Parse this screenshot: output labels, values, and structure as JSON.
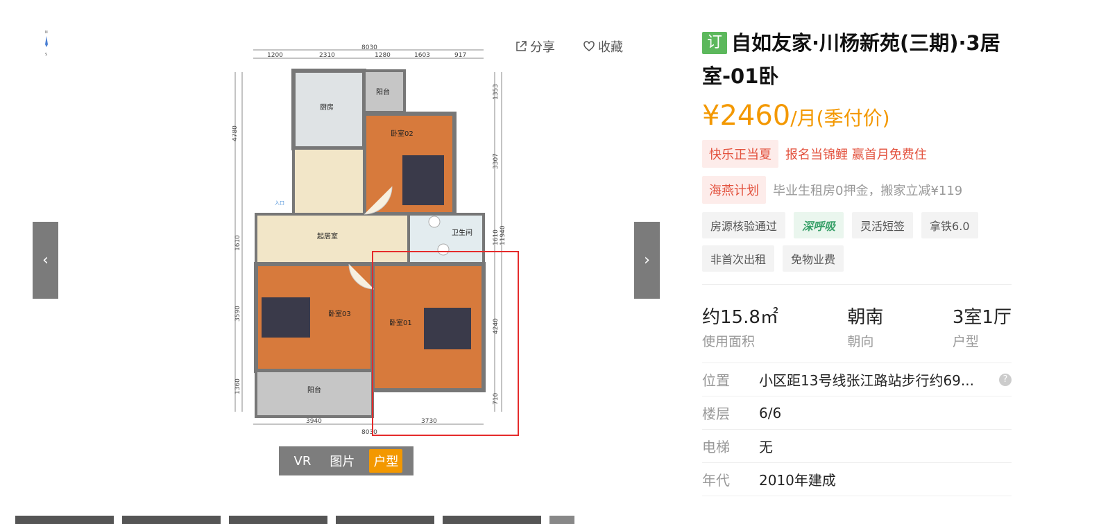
{
  "actions": {
    "share": "分享",
    "favorite": "收藏"
  },
  "media_tabs": [
    "VR",
    "图片",
    "户型"
  ],
  "active_tab": "户型",
  "floorplan": {
    "top_dims": [
      "8030",
      "1200",
      "2310",
      "1280",
      "1603",
      "917"
    ],
    "bottom_dims": [
      "3940",
      "3730",
      "8030"
    ],
    "left_dims": [
      "4780",
      "11940",
      "1610",
      "3590",
      "1360"
    ],
    "right_dims": [
      "1353",
      "3307",
      "1610",
      "11940",
      "4240",
      "710"
    ],
    "rooms": {
      "kitchen": "厨房",
      "balcony_top": "阳台",
      "bedroom02": "卧室02",
      "entrance": "入口",
      "living": "起居室",
      "bathroom": "卫生间",
      "bedroom03": "卧室03",
      "bedroom01": "卧室01",
      "balcony_bottom": "阳台"
    }
  },
  "listing": {
    "badge": "订",
    "title": "自如友家·川杨新苑(三期)·3居室-01卧",
    "price": "¥2460",
    "price_unit": "/月(季付价)"
  },
  "promos": [
    {
      "tag": "快乐正当夏",
      "text": "报名当锦鲤 赢首月免费住",
      "style": "red"
    },
    {
      "tag": "海燕计划",
      "text": "毕业生租房0押金，搬家立减¥119",
      "style": "grey"
    }
  ],
  "tags": [
    "房源核验通过",
    "深呼吸",
    "灵活短签",
    "拿铁6.0",
    "非首次出租",
    "免物业费"
  ],
  "stats": [
    {
      "value": "约15.8㎡",
      "label": "使用面积"
    },
    {
      "value": "朝南",
      "label": "朝向"
    },
    {
      "value": "3室1厅",
      "label": "户型"
    }
  ],
  "info": [
    {
      "key": "位置",
      "value": "小区距13号线张江路站步行约69..."
    },
    {
      "key": "楼层",
      "value": "6/6"
    },
    {
      "key": "电梯",
      "value": "无"
    },
    {
      "key": "年代",
      "value": "2010年建成"
    }
  ],
  "colors": {
    "accent": "#f39800",
    "badge": "#5cb85c",
    "promo": "#e3523e",
    "highlight": "#e52b2b"
  }
}
